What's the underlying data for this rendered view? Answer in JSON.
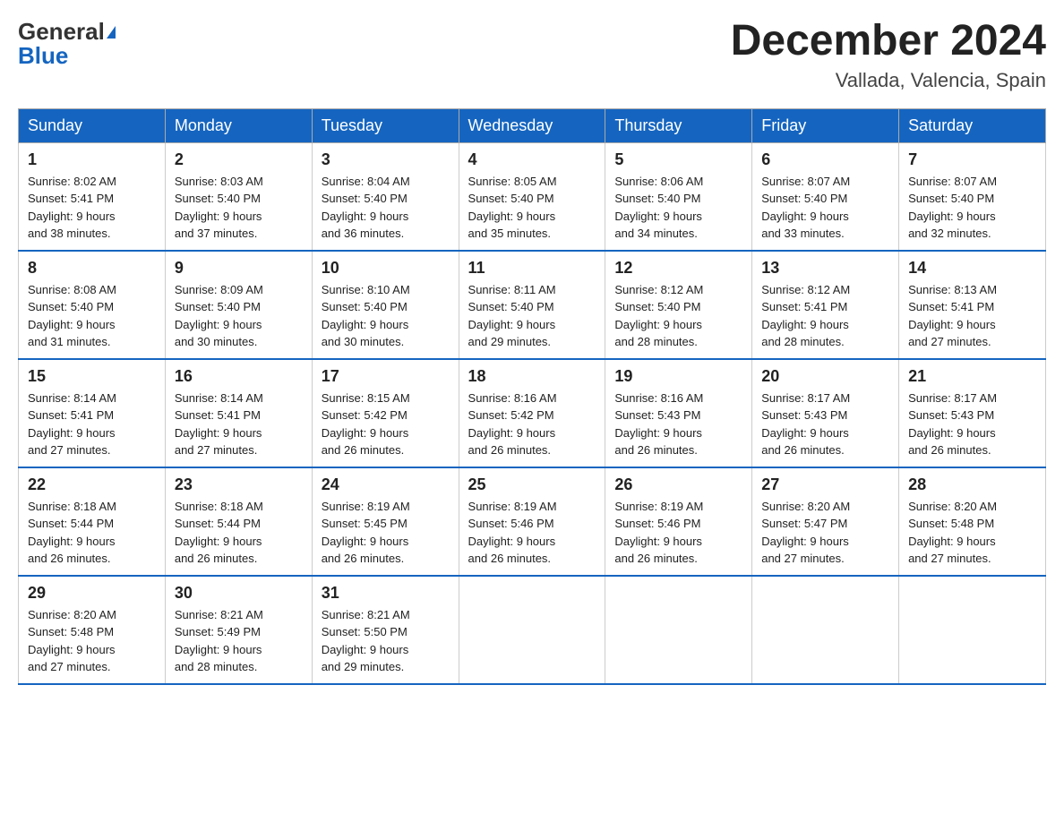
{
  "header": {
    "logo_general": "General",
    "logo_blue": "Blue",
    "title": "December 2024",
    "subtitle": "Vallada, Valencia, Spain"
  },
  "days_of_week": [
    "Sunday",
    "Monday",
    "Tuesday",
    "Wednesday",
    "Thursday",
    "Friday",
    "Saturday"
  ],
  "weeks": [
    [
      {
        "day": "1",
        "sunrise": "8:02 AM",
        "sunset": "5:41 PM",
        "daylight": "9 hours and 38 minutes."
      },
      {
        "day": "2",
        "sunrise": "8:03 AM",
        "sunset": "5:40 PM",
        "daylight": "9 hours and 37 minutes."
      },
      {
        "day": "3",
        "sunrise": "8:04 AM",
        "sunset": "5:40 PM",
        "daylight": "9 hours and 36 minutes."
      },
      {
        "day": "4",
        "sunrise": "8:05 AM",
        "sunset": "5:40 PM",
        "daylight": "9 hours and 35 minutes."
      },
      {
        "day": "5",
        "sunrise": "8:06 AM",
        "sunset": "5:40 PM",
        "daylight": "9 hours and 34 minutes."
      },
      {
        "day": "6",
        "sunrise": "8:07 AM",
        "sunset": "5:40 PM",
        "daylight": "9 hours and 33 minutes."
      },
      {
        "day": "7",
        "sunrise": "8:07 AM",
        "sunset": "5:40 PM",
        "daylight": "9 hours and 32 minutes."
      }
    ],
    [
      {
        "day": "8",
        "sunrise": "8:08 AM",
        "sunset": "5:40 PM",
        "daylight": "9 hours and 31 minutes."
      },
      {
        "day": "9",
        "sunrise": "8:09 AM",
        "sunset": "5:40 PM",
        "daylight": "9 hours and 30 minutes."
      },
      {
        "day": "10",
        "sunrise": "8:10 AM",
        "sunset": "5:40 PM",
        "daylight": "9 hours and 30 minutes."
      },
      {
        "day": "11",
        "sunrise": "8:11 AM",
        "sunset": "5:40 PM",
        "daylight": "9 hours and 29 minutes."
      },
      {
        "day": "12",
        "sunrise": "8:12 AM",
        "sunset": "5:40 PM",
        "daylight": "9 hours and 28 minutes."
      },
      {
        "day": "13",
        "sunrise": "8:12 AM",
        "sunset": "5:41 PM",
        "daylight": "9 hours and 28 minutes."
      },
      {
        "day": "14",
        "sunrise": "8:13 AM",
        "sunset": "5:41 PM",
        "daylight": "9 hours and 27 minutes."
      }
    ],
    [
      {
        "day": "15",
        "sunrise": "8:14 AM",
        "sunset": "5:41 PM",
        "daylight": "9 hours and 27 minutes."
      },
      {
        "day": "16",
        "sunrise": "8:14 AM",
        "sunset": "5:41 PM",
        "daylight": "9 hours and 27 minutes."
      },
      {
        "day": "17",
        "sunrise": "8:15 AM",
        "sunset": "5:42 PM",
        "daylight": "9 hours and 26 minutes."
      },
      {
        "day": "18",
        "sunrise": "8:16 AM",
        "sunset": "5:42 PM",
        "daylight": "9 hours and 26 minutes."
      },
      {
        "day": "19",
        "sunrise": "8:16 AM",
        "sunset": "5:43 PM",
        "daylight": "9 hours and 26 minutes."
      },
      {
        "day": "20",
        "sunrise": "8:17 AM",
        "sunset": "5:43 PM",
        "daylight": "9 hours and 26 minutes."
      },
      {
        "day": "21",
        "sunrise": "8:17 AM",
        "sunset": "5:43 PM",
        "daylight": "9 hours and 26 minutes."
      }
    ],
    [
      {
        "day": "22",
        "sunrise": "8:18 AM",
        "sunset": "5:44 PM",
        "daylight": "9 hours and 26 minutes."
      },
      {
        "day": "23",
        "sunrise": "8:18 AM",
        "sunset": "5:44 PM",
        "daylight": "9 hours and 26 minutes."
      },
      {
        "day": "24",
        "sunrise": "8:19 AM",
        "sunset": "5:45 PM",
        "daylight": "9 hours and 26 minutes."
      },
      {
        "day": "25",
        "sunrise": "8:19 AM",
        "sunset": "5:46 PM",
        "daylight": "9 hours and 26 minutes."
      },
      {
        "day": "26",
        "sunrise": "8:19 AM",
        "sunset": "5:46 PM",
        "daylight": "9 hours and 26 minutes."
      },
      {
        "day": "27",
        "sunrise": "8:20 AM",
        "sunset": "5:47 PM",
        "daylight": "9 hours and 27 minutes."
      },
      {
        "day": "28",
        "sunrise": "8:20 AM",
        "sunset": "5:48 PM",
        "daylight": "9 hours and 27 minutes."
      }
    ],
    [
      {
        "day": "29",
        "sunrise": "8:20 AM",
        "sunset": "5:48 PM",
        "daylight": "9 hours and 27 minutes."
      },
      {
        "day": "30",
        "sunrise": "8:21 AM",
        "sunset": "5:49 PM",
        "daylight": "9 hours and 28 minutes."
      },
      {
        "day": "31",
        "sunrise": "8:21 AM",
        "sunset": "5:50 PM",
        "daylight": "9 hours and 29 minutes."
      },
      null,
      null,
      null,
      null
    ]
  ],
  "labels": {
    "sunrise": "Sunrise:",
    "sunset": "Sunset:",
    "daylight": "Daylight:"
  }
}
